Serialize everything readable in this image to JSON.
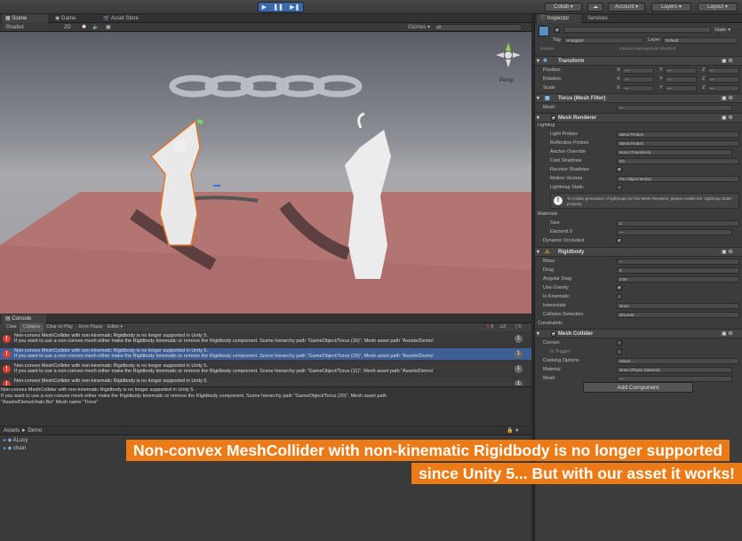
{
  "toolbar": {
    "collab": "Collab ▾",
    "cloud": "☁",
    "account": "Account ▾",
    "layers": "Layers ▾",
    "layout": "Layout ▾",
    "play": "▶",
    "pause": "❚❚",
    "step": "▶❚"
  },
  "tabs": {
    "scene": "Scene",
    "game": "Game",
    "asset_store": "Asset Store"
  },
  "scene_bar": {
    "shaded": "Shaded",
    "mode_2d": "2D",
    "gizmos": "Gizmos ▾",
    "search_placeholder": "All",
    "persp": "Persp"
  },
  "console": {
    "tab": "Console",
    "buttons": [
      "Clear",
      "Collapse",
      "Clear on Play",
      "Error Pause",
      "Editor ▾"
    ],
    "counts": {
      "errors": "9",
      "warnings": "0",
      "infos": "0"
    },
    "rows": [
      {
        "line1": "Non-convex MeshCollider with non-kinematic Rigidbody is no longer supported in Unity 5.",
        "line2": "If you want to use a non-convex mesh either make the Rigidbody kinematic or remove the Rigidbody component. Scene hierarchy path \"GameObject/Torus (16)\", Mesh asset path \"Assets/Demo/",
        "count": "1"
      },
      {
        "line1": "Non-convex MeshCollider with non-kinematic Rigidbody is no longer supported in Unity 5.",
        "line2": "If you want to use a non-convex mesh either make the Rigidbody kinematic or remove the Rigidbody component. Scene hierarchy path \"GameObject/Torus (20)\", Mesh asset path \"Assets/Demo/",
        "count": "1"
      },
      {
        "line1": "Non-convex MeshCollider with non-kinematic Rigidbody is no longer supported in Unity 5.",
        "line2": "If you want to use a non-convex mesh either make the Rigidbody kinematic or remove the Rigidbody component. Scene hierarchy path \"GameObject/Torus (11)\", Mesh asset path \"Assets/Demo/",
        "count": "1"
      },
      {
        "line1": "Non-convex MeshCollider with non-kinematic Rigidbody is no longer supported in Unity 5.",
        "line2": "",
        "count": "1"
      }
    ],
    "detail": [
      "Non-convex MeshCollider with non-kinematic Rigidbody is no longer supported in Unity 5.",
      "If you want to use a non-convex mesh either make the Rigidbody kinematic or remove the Rigidbody component. Scene hierarchy path \"GameObject/Torus (20)\", Mesh asset path",
      "\"Assets/Demo/chain.fbx\" Mesh name \"Torus\""
    ]
  },
  "project": {
    "breadcrumb_assets": "Assets",
    "breadcrumb_sep": "►",
    "breadcrumb_demo": "Demo",
    "items": [
      "ALucy",
      "chain"
    ]
  },
  "inspector": {
    "tab": "Inspector",
    "services": "Services",
    "static": "Static ▾",
    "tag_label": "Tag",
    "tag_value": "Untagged",
    "layer_label": "Layer",
    "layer_value": "Default",
    "multi": "Multiple",
    "prefab_note": "Instance Management Disabled",
    "transform": {
      "title": "Transform",
      "rows": [
        "Position",
        "Rotation",
        "Scale"
      ],
      "axes": [
        "X",
        "Y",
        "Z"
      ],
      "dash": "—"
    },
    "mesh_filter": {
      "title": "Torus (Mesh Filter)",
      "mesh_label": "Mesh",
      "mesh_value": "—"
    },
    "mesh_renderer": {
      "title": "Mesh Renderer",
      "lighting": "Lighting",
      "rows": [
        [
          "Light Probes",
          "Blend Probes"
        ],
        [
          "Reflection Probes",
          "Blend Probes"
        ],
        [
          "Anchor Override",
          "None (Transform)"
        ],
        [
          "Cast Shadows",
          "On"
        ],
        [
          "Receive Shadows",
          "✔"
        ],
        [
          "Motion Vectors",
          "Per Object Motion"
        ],
        [
          "Lightmap Static",
          ""
        ]
      ],
      "info": "To enable generation of lightmaps for this Mesh Renderer, please enable the 'Lightmap Static' property.",
      "materials": "Materials",
      "size_label": "Size",
      "size_value": "1",
      "element_label": "Element 0",
      "element_value": "—",
      "dyn_label": "Dynamic Occluded",
      "dyn_value": "✔"
    },
    "rigidbody": {
      "title": "Rigidbody",
      "rows": [
        [
          "Mass",
          "—"
        ],
        [
          "Drag",
          "0"
        ],
        [
          "Angular Drag",
          "0.05"
        ],
        [
          "Use Gravity",
          "✔"
        ],
        [
          "Is Kinematic",
          ""
        ],
        [
          "Interpolate",
          "None"
        ],
        [
          "Collision Detection",
          "Discrete"
        ]
      ],
      "constraints": "Constraints"
    },
    "mesh_collider": {
      "title": "Mesh Collider",
      "rows": [
        [
          "Convex",
          ""
        ],
        [
          "Is Trigger",
          ""
        ],
        [
          "Cooking Options",
          "Mixed ..."
        ],
        [
          "Material",
          "None (Physic Material)"
        ],
        [
          "Mesh",
          "—"
        ]
      ]
    },
    "add_component": "Add Component"
  },
  "banner": {
    "line1": "Non-convex MeshCollider with non-kinematic Rigidbody is no longer supported",
    "line2": "since Unity 5... But with our asset it works!"
  },
  "colors": {
    "accent_orange": "#eb7a17",
    "selection_blue": "#3e5f96",
    "error_red": "#e03c2f"
  }
}
